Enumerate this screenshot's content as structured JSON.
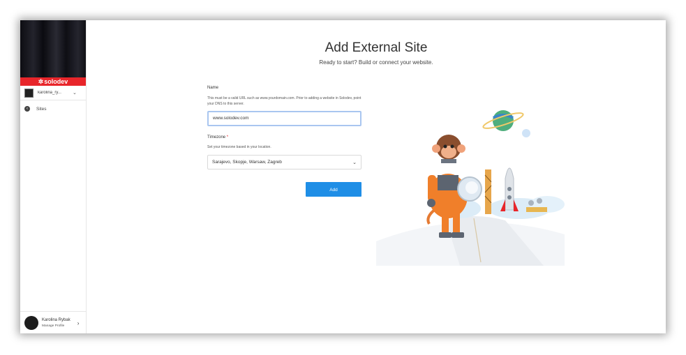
{
  "sidebar": {
    "brand": "solodev",
    "account_name": "karolina_ry...",
    "nav": [
      {
        "label": "Sites",
        "icon": "chevron-left-circle-icon"
      }
    ],
    "profile": {
      "name": "Karolina Rybak",
      "manage": "Manage Profile"
    }
  },
  "page": {
    "title": "Add External Site",
    "subtitle": "Ready to start? Build or connect your website."
  },
  "form": {
    "name_label": "Name",
    "name_help": "This must be a valid URL such as www.yourdomain.com. Prior to adding a website in Solodev, point your DNS to this server.",
    "name_value": "www.solodev.com",
    "timezone_label": "Timezone",
    "timezone_required": "*",
    "timezone_help": "Set your timezone based in your location.",
    "timezone_value": "Sarajevo, Skopje, Warsaw, Zagreb",
    "submit_label": "Add"
  },
  "colors": {
    "brand_red": "#e8252a",
    "button_blue": "#1f8ee6",
    "input_focus": "#a9c6f0"
  }
}
